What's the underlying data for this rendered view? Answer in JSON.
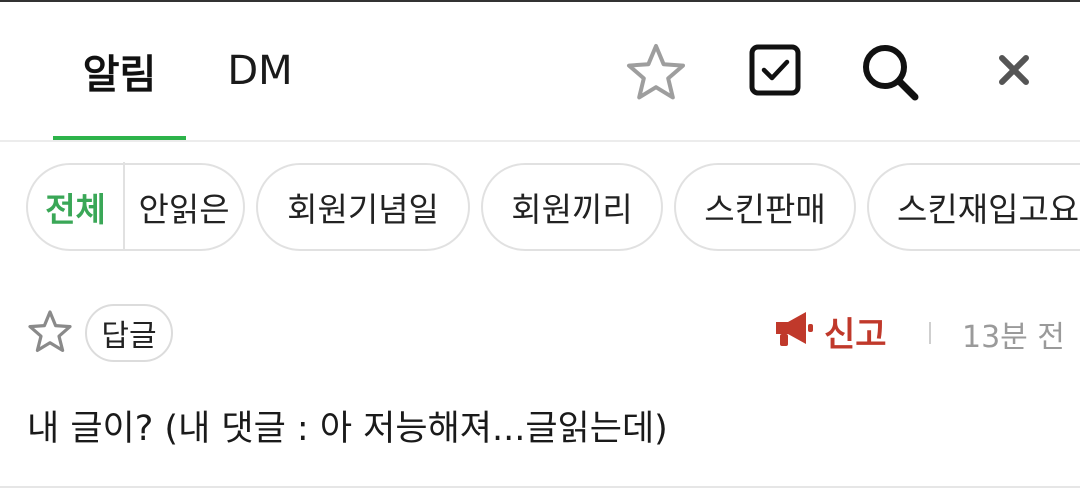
{
  "tabs": {
    "alarm": "알림",
    "dm": "DM",
    "active": "알림"
  },
  "header_icons": {
    "favorite": "star-outline-icon",
    "select": "checkbox-icon",
    "search": "search-icon",
    "close": "close-icon"
  },
  "filters": {
    "all": "전체",
    "unread": "안읽은",
    "chips": [
      "회원기념일",
      "회원끼리",
      "스킨판매",
      "스킨재입고요"
    ]
  },
  "notification": {
    "badge": "답글",
    "report_label": "신고",
    "report_icon": "megaphone-icon",
    "time": "13분 전",
    "message": "내 글이? (내 댓글 : 아 저능해져...글읽는데)"
  },
  "colors": {
    "accent_green": "#2db34a",
    "active_filter_green": "#3aa757",
    "report_red": "#c0392b",
    "muted_gray": "#9a9a9a"
  }
}
